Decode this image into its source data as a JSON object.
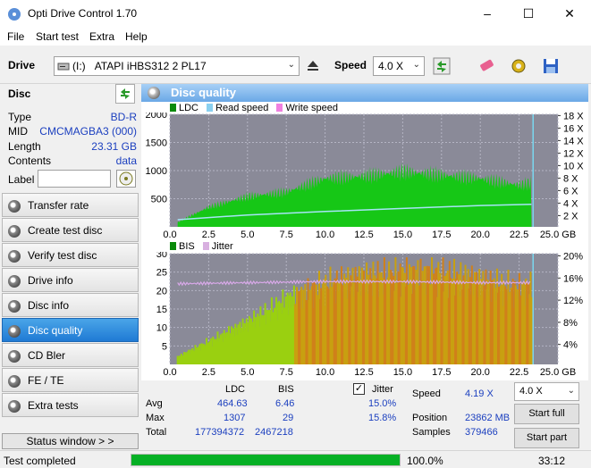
{
  "window": {
    "title": "Opti Drive Control 1.70"
  },
  "menu": {
    "file": "File",
    "start_test": "Start test",
    "extra": "Extra",
    "help": "Help"
  },
  "toolbar": {
    "drive_label": "Drive",
    "drive_letter": "(I:)",
    "drive_value": "ATAPI iHBS312  2 PL17",
    "speed_label": "Speed",
    "speed_value": "4.0 X"
  },
  "disc": {
    "header": "Disc",
    "rows": [
      {
        "key": "Type",
        "value": "BD-R"
      },
      {
        "key": "MID",
        "value": "CMCMAGBA3 (000)"
      },
      {
        "key": "Length",
        "value": "23.31 GB"
      },
      {
        "key": "Contents",
        "value": "data"
      }
    ],
    "label_key": "Label",
    "label_value": ""
  },
  "nav": [
    {
      "label": "Transfer rate",
      "active": false
    },
    {
      "label": "Create test disc",
      "active": false
    },
    {
      "label": "Verify test disc",
      "active": false
    },
    {
      "label": "Drive info",
      "active": false
    },
    {
      "label": "Disc info",
      "active": false
    },
    {
      "label": "Disc quality",
      "active": true
    },
    {
      "label": "CD Bler",
      "active": false
    },
    {
      "label": "FE / TE",
      "active": false
    },
    {
      "label": "Extra tests",
      "active": false
    }
  ],
  "status_window_btn": "Status window > >",
  "panel_title": "Disc quality",
  "chart_data": [
    {
      "type": "area",
      "legend": [
        "LDC",
        "Read speed",
        "Write speed"
      ],
      "x_ticks": [
        "0.0",
        "2.5",
        "5.0",
        "7.5",
        "10.0",
        "12.5",
        "15.0",
        "17.5",
        "20.0",
        "22.5",
        "25.0 GB"
      ],
      "y_left_ticks": [
        "2000",
        "1500",
        "1000",
        "500"
      ],
      "y_right_ticks": [
        "18 X",
        "16 X",
        "14 X",
        "12 X",
        "10 X",
        "8 X",
        "6 X",
        "4 X",
        "2 X"
      ],
      "xlim": [
        0,
        25
      ],
      "ylim": [
        0,
        2000
      ],
      "ldc_x": [
        0.5,
        1.0,
        2.5,
        5.0,
        7.5,
        10.0,
        12.5,
        15.0,
        17.5,
        20.0,
        22.5,
        23.3
      ],
      "ldc_y": [
        80,
        150,
        350,
        540,
        620,
        860,
        900,
        980,
        920,
        860,
        740,
        780
      ],
      "read_speed_x": [
        0.5,
        5.0,
        10.0,
        15.0,
        20.0,
        23.3
      ],
      "read_speed_y": [
        1.2,
        2.0,
        2.6,
        3.1,
        3.6,
        3.8
      ]
    },
    {
      "type": "area",
      "legend": [
        "BIS",
        "Jitter"
      ],
      "x_ticks": [
        "0.0",
        "2.5",
        "5.0",
        "7.5",
        "10.0",
        "12.5",
        "15.0",
        "17.5",
        "20.0",
        "22.5",
        "25.0 GB"
      ],
      "y_left_ticks": [
        "30",
        "25",
        "20",
        "15",
        "10",
        "5"
      ],
      "y_right_ticks": [
        "20%",
        "16%",
        "12%",
        "8%",
        "4%"
      ],
      "xlim": [
        0,
        25
      ],
      "ylim": [
        0,
        30
      ],
      "bis_x": [
        0.5,
        2.5,
        5.0,
        7.5,
        10.0,
        12.5,
        15.0,
        17.5,
        20.0,
        22.5,
        23.3
      ],
      "bis_y": [
        2,
        6,
        11,
        17,
        21,
        23,
        24,
        24,
        22,
        20,
        21
      ],
      "jitter_x": [
        0.5,
        5.0,
        10.0,
        15.0,
        20.0,
        23.3
      ],
      "jitter_y": [
        14.8,
        15.0,
        15.2,
        15.2,
        15.0,
        15.0
      ]
    }
  ],
  "stats": {
    "col_ldc": "LDC",
    "col_bis": "BIS",
    "col_jitter": "Jitter",
    "avg_label": "Avg",
    "max_label": "Max",
    "total_label": "Total",
    "avg_ldc": "464.63",
    "avg_bis": "6.46",
    "avg_jitter": "15.0%",
    "max_ldc": "1307",
    "max_bis": "29",
    "max_jitter": "15.8%",
    "total_ldc": "177394372",
    "total_bis": "2467218",
    "speed_label": "Speed",
    "speed_value": "4.19 X",
    "position_label": "Position",
    "position_value": "23862 MB",
    "samples_label": "Samples",
    "samples_value": "379466",
    "speed_select": "4.0 X",
    "start_full": "Start full",
    "start_part": "Start part"
  },
  "statusbar": {
    "text": "Test completed",
    "percent": "100.0%",
    "time": "33:12",
    "progress": 1.0
  }
}
